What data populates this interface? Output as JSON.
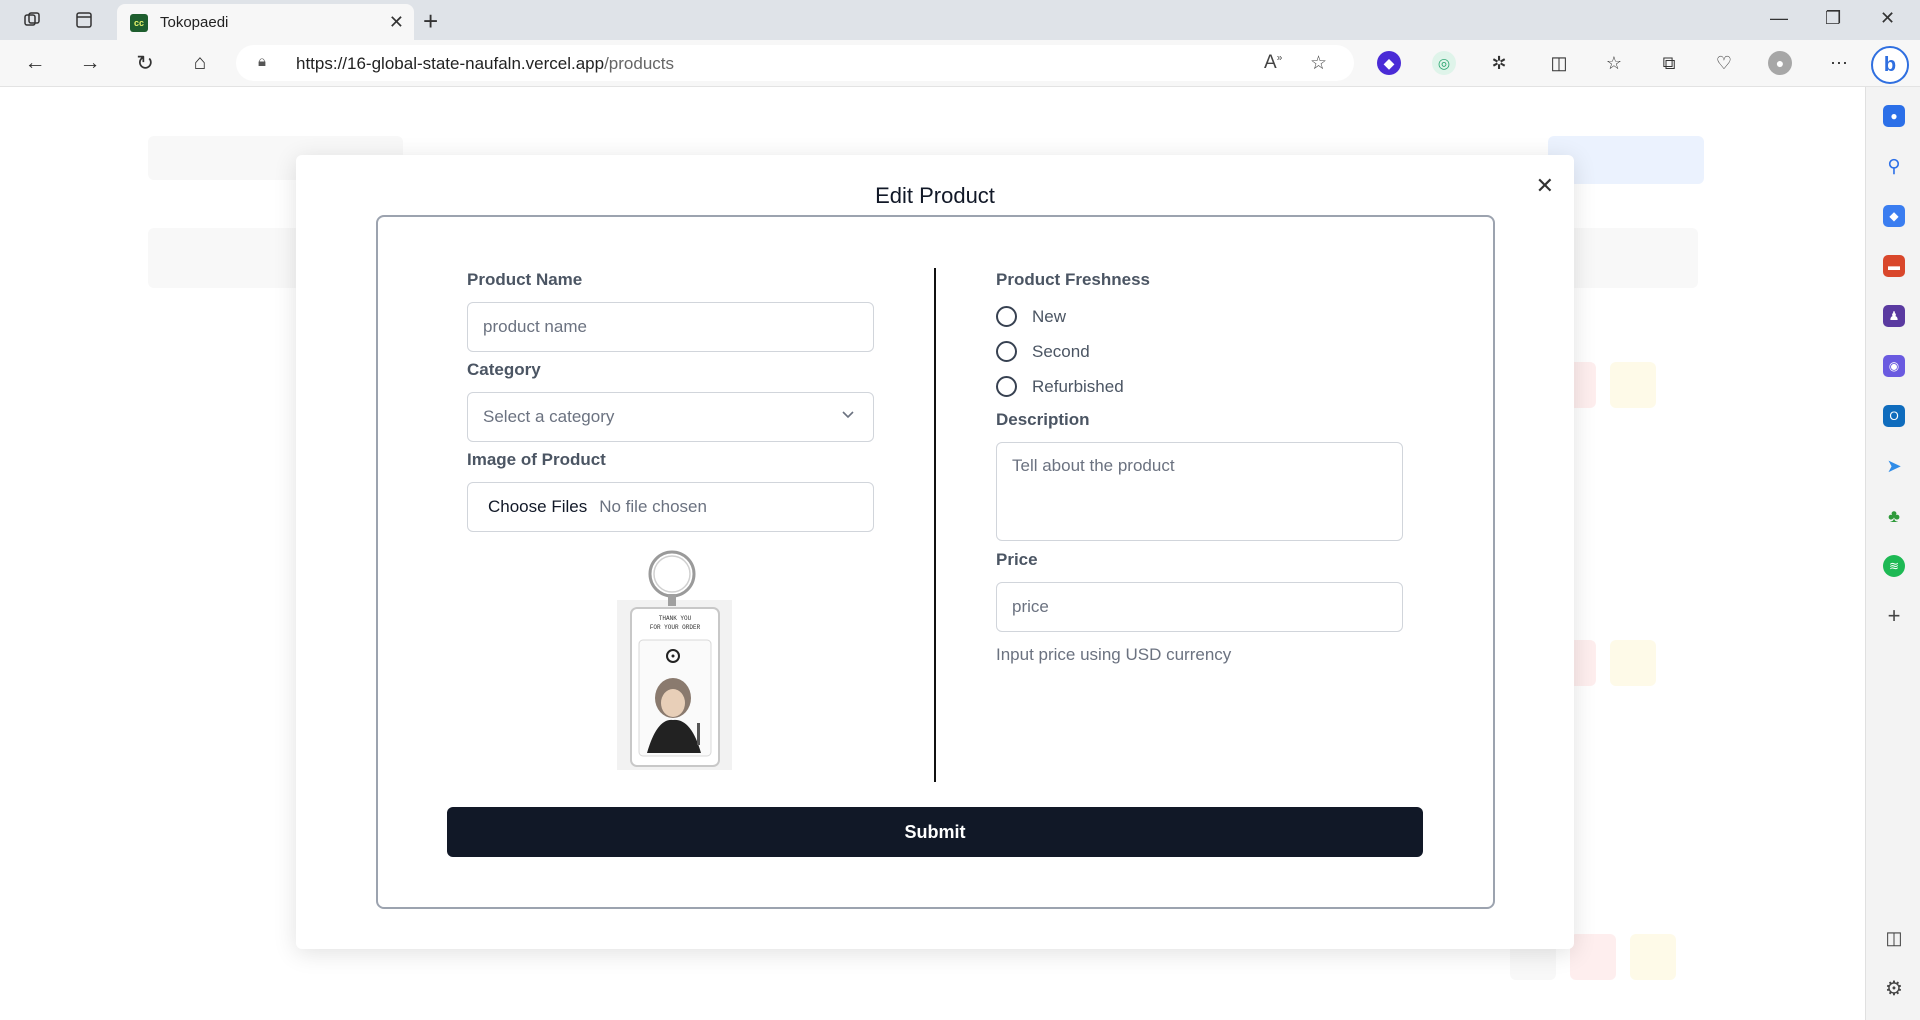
{
  "browser": {
    "tab_title": "Tokopaedi",
    "favicon_text": "cc",
    "url_host": "https://16-global-state-naufaln.vercel.app",
    "url_path": "/products"
  },
  "modal": {
    "title": "Edit Product",
    "product_name": {
      "label": "Product Name",
      "placeholder": "product name",
      "value": ""
    },
    "category": {
      "label": "Category",
      "selected": "Select a category"
    },
    "image": {
      "label": "Image of Product",
      "button": "Choose Files",
      "status": "No file chosen",
      "preview_caption_line1": "THANK YOU",
      "preview_caption_line2": "FOR YOUR ORDER"
    },
    "freshness": {
      "label": "Product Freshness",
      "options": [
        "New",
        "Second",
        "Refurbished"
      ]
    },
    "description": {
      "label": "Description",
      "placeholder": "Tell about the product"
    },
    "price": {
      "label": "Price",
      "placeholder": "price",
      "hint": "Input price using USD currency"
    },
    "submit_label": "Submit",
    "close_glyph": "✕"
  },
  "colors": {
    "submit_bg": "#111827",
    "label_text": "#4b5563",
    "border": "#d1d5db"
  }
}
